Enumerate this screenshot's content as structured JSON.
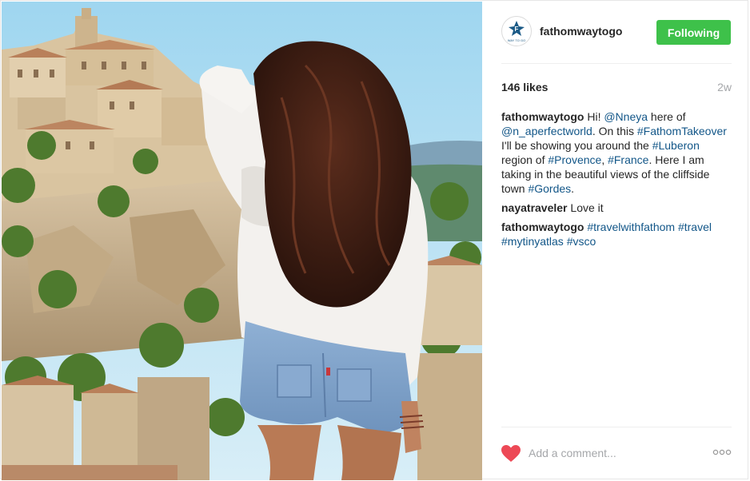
{
  "post": {
    "username": "fathomwaytogo",
    "follow_label": "Following",
    "likes": "146 likes",
    "time_ago": "2w",
    "comment_placeholder": "Add a comment...",
    "avatar_text": "WAY TO GO"
  },
  "comments": [
    {
      "user": "fathomwaytogo",
      "parts": [
        {
          "t": "Hi! ",
          "link": false
        },
        {
          "t": "@Nneya",
          "link": true
        },
        {
          "t": " here of ",
          "link": false
        },
        {
          "t": "@n_aperfectworld",
          "link": true
        },
        {
          "t": ". On this ",
          "link": false
        },
        {
          "t": "#FathomTakeover",
          "link": true
        },
        {
          "t": " I'll be showing you around the ",
          "link": false
        },
        {
          "t": "#Luberon",
          "link": true
        },
        {
          "t": " region of ",
          "link": false
        },
        {
          "t": "#Provence",
          "link": true
        },
        {
          "t": ", ",
          "link": false
        },
        {
          "t": "#France",
          "link": true
        },
        {
          "t": ". Here I am taking in the beautiful views of the cliffside town ",
          "link": false
        },
        {
          "t": "#Gordes",
          "link": true
        },
        {
          "t": ".",
          "link": false
        }
      ]
    },
    {
      "user": "nayatraveler",
      "parts": [
        {
          "t": "Love it",
          "link": false
        }
      ]
    },
    {
      "user": "fathomwaytogo",
      "parts": [
        {
          "t": "#travelwithfathom",
          "link": true
        },
        {
          "t": " ",
          "link": false
        },
        {
          "t": "#travel",
          "link": true
        },
        {
          "t": " ",
          "link": false
        },
        {
          "t": "#mytinyatlas",
          "link": true
        },
        {
          "t": " ",
          "link": false
        },
        {
          "t": "#vsco",
          "link": true
        }
      ]
    }
  ],
  "colors": {
    "follow_button": "#3ec14a",
    "link": "#125688",
    "heart": "#ed4956",
    "muted": "#a5a7aa"
  },
  "icons": [
    "heart-icon",
    "more-options-icon",
    "fathom-logo-icon"
  ]
}
